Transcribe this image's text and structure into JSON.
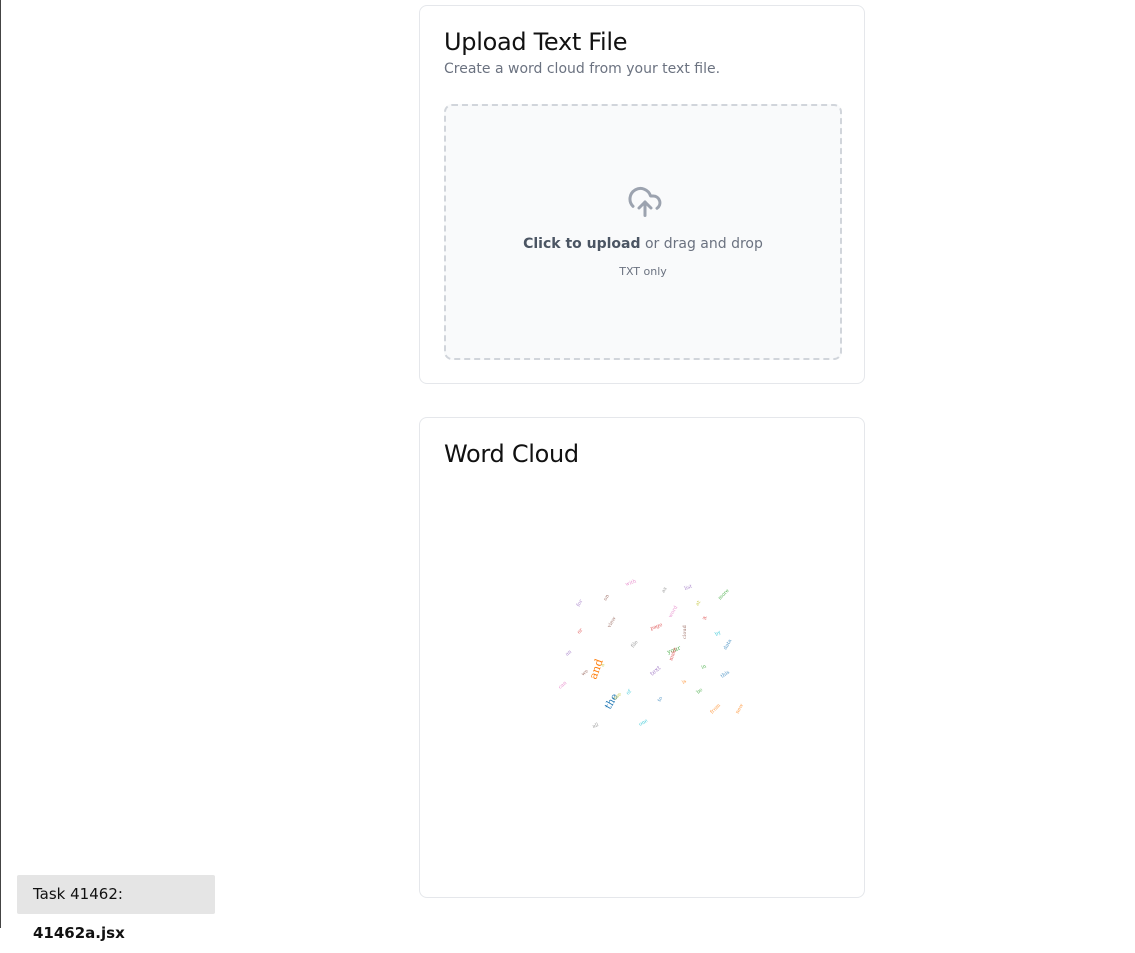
{
  "upload_card": {
    "title": "Upload Text File",
    "subtitle": "Create a word cloud from your text file.",
    "dropzone": {
      "icon": "cloud-upload-icon",
      "action_label": "Click to upload",
      "action_suffix": " or drag and drop",
      "hint": "TXT only"
    }
  },
  "cloud_card": {
    "title": "Word Cloud",
    "words": [
      {
        "text": "and",
        "color": "#ff7f0e"
      },
      {
        "text": "the",
        "color": "#1f77b4"
      },
      {
        "text": "your",
        "color": "#2ca02c"
      },
      {
        "text": "text",
        "color": "#9467bd"
      },
      {
        "text": "make",
        "color": "#d62728"
      },
      {
        "text": "cloud",
        "color": "#8c564b"
      },
      {
        "text": "word",
        "color": "#e377c2"
      },
      {
        "text": "file",
        "color": "#7f7f7f"
      },
      {
        "text": "a",
        "color": "#bcbd22"
      },
      {
        "text": "of",
        "color": "#17becf"
      },
      {
        "text": "to",
        "color": "#1f77b4"
      },
      {
        "text": "is",
        "color": "#ff7f0e"
      },
      {
        "text": "in",
        "color": "#2ca02c"
      },
      {
        "text": "it",
        "color": "#d62728"
      },
      {
        "text": "for",
        "color": "#9467bd"
      },
      {
        "text": "on",
        "color": "#8c564b"
      },
      {
        "text": "with",
        "color": "#e377c2"
      },
      {
        "text": "as",
        "color": "#7f7f7f"
      },
      {
        "text": "at",
        "color": "#bcbd22"
      },
      {
        "text": "by",
        "color": "#17becf"
      },
      {
        "text": "this",
        "color": "#1f77b4"
      },
      {
        "text": "from",
        "color": "#ff7f0e"
      },
      {
        "text": "be",
        "color": "#2ca02c"
      },
      {
        "text": "or",
        "color": "#d62728"
      },
      {
        "text": "an",
        "color": "#9467bd"
      },
      {
        "text": "we",
        "color": "#8c564b"
      },
      {
        "text": "can",
        "color": "#e377c2"
      },
      {
        "text": "all",
        "color": "#7f7f7f"
      },
      {
        "text": "use",
        "color": "#bcbd22"
      },
      {
        "text": "one",
        "color": "#17becf"
      },
      {
        "text": "data",
        "color": "#1f77b4"
      },
      {
        "text": "new",
        "color": "#ff7f0e"
      },
      {
        "text": "more",
        "color": "#2ca02c"
      },
      {
        "text": "page",
        "color": "#d62728"
      },
      {
        "text": "list",
        "color": "#9467bd"
      },
      {
        "text": "view",
        "color": "#8c564b"
      }
    ]
  },
  "task_badge": {
    "prefix": "Task 41462: ",
    "file": "41462a.jsx"
  }
}
